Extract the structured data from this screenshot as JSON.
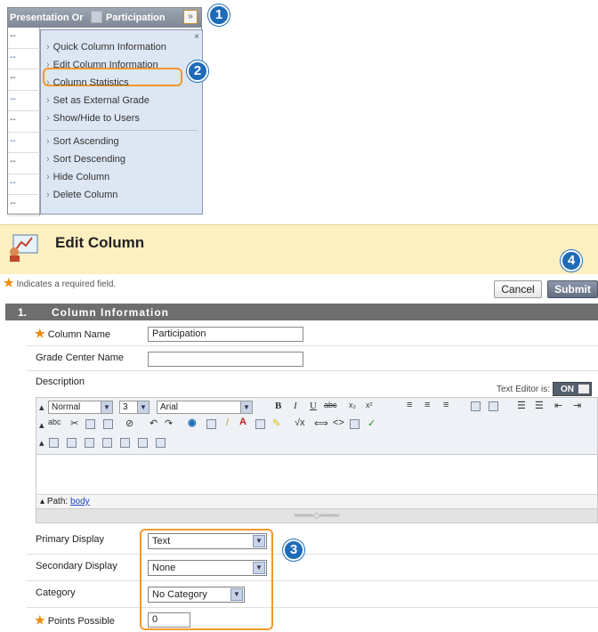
{
  "grade_center": {
    "column_header_1": "Presentation Or",
    "column_header_2": "Participation",
    "row_cells": [
      "--",
      "--",
      "--",
      "--",
      "--",
      "--",
      "--",
      "--",
      "--"
    ],
    "menu": {
      "close": "×",
      "items": [
        "Quick Column Information",
        "Edit Column Information",
        "Column Statistics",
        "Set as External Grade",
        "Show/Hide to Users",
        "Sort Ascending",
        "Sort Descending",
        "Hide Column",
        "Delete Column"
      ]
    }
  },
  "callouts": [
    "1",
    "2",
    "3",
    "4"
  ],
  "edit_column": {
    "title": "Edit Column",
    "required_note": "Indicates a required field.",
    "required_star": "★",
    "cancel_label": "Cancel",
    "submit_label": "Submit",
    "section_number": "1.",
    "section_title": "Column Information",
    "column_name_label": "Column Name",
    "column_name_value": "Participation",
    "grade_center_name_label": "Grade Center  Name",
    "grade_center_name_value": "",
    "description_label": "Description",
    "text_editor_label": "Text Editor is:",
    "text_editor_state": "ON",
    "editor": {
      "format_select": "Normal",
      "size_select": "3",
      "font_select": "Arial",
      "path_label": "Path:",
      "path_value": "body"
    },
    "primary_display_label": "Primary Display",
    "primary_display_value": "Text",
    "secondary_display_label": "Secondary Display",
    "secondary_display_value": "None",
    "category_label": "Category",
    "category_value": "No Category",
    "points_possible_label": "Points Possible",
    "points_possible_value": "0"
  },
  "colors": {
    "header_bg": "#fcefc0",
    "section_bg": "#6e6e6e",
    "highlight": "#f09a2e",
    "badge": "#1e6bb8",
    "required_star": "#f08b00"
  }
}
